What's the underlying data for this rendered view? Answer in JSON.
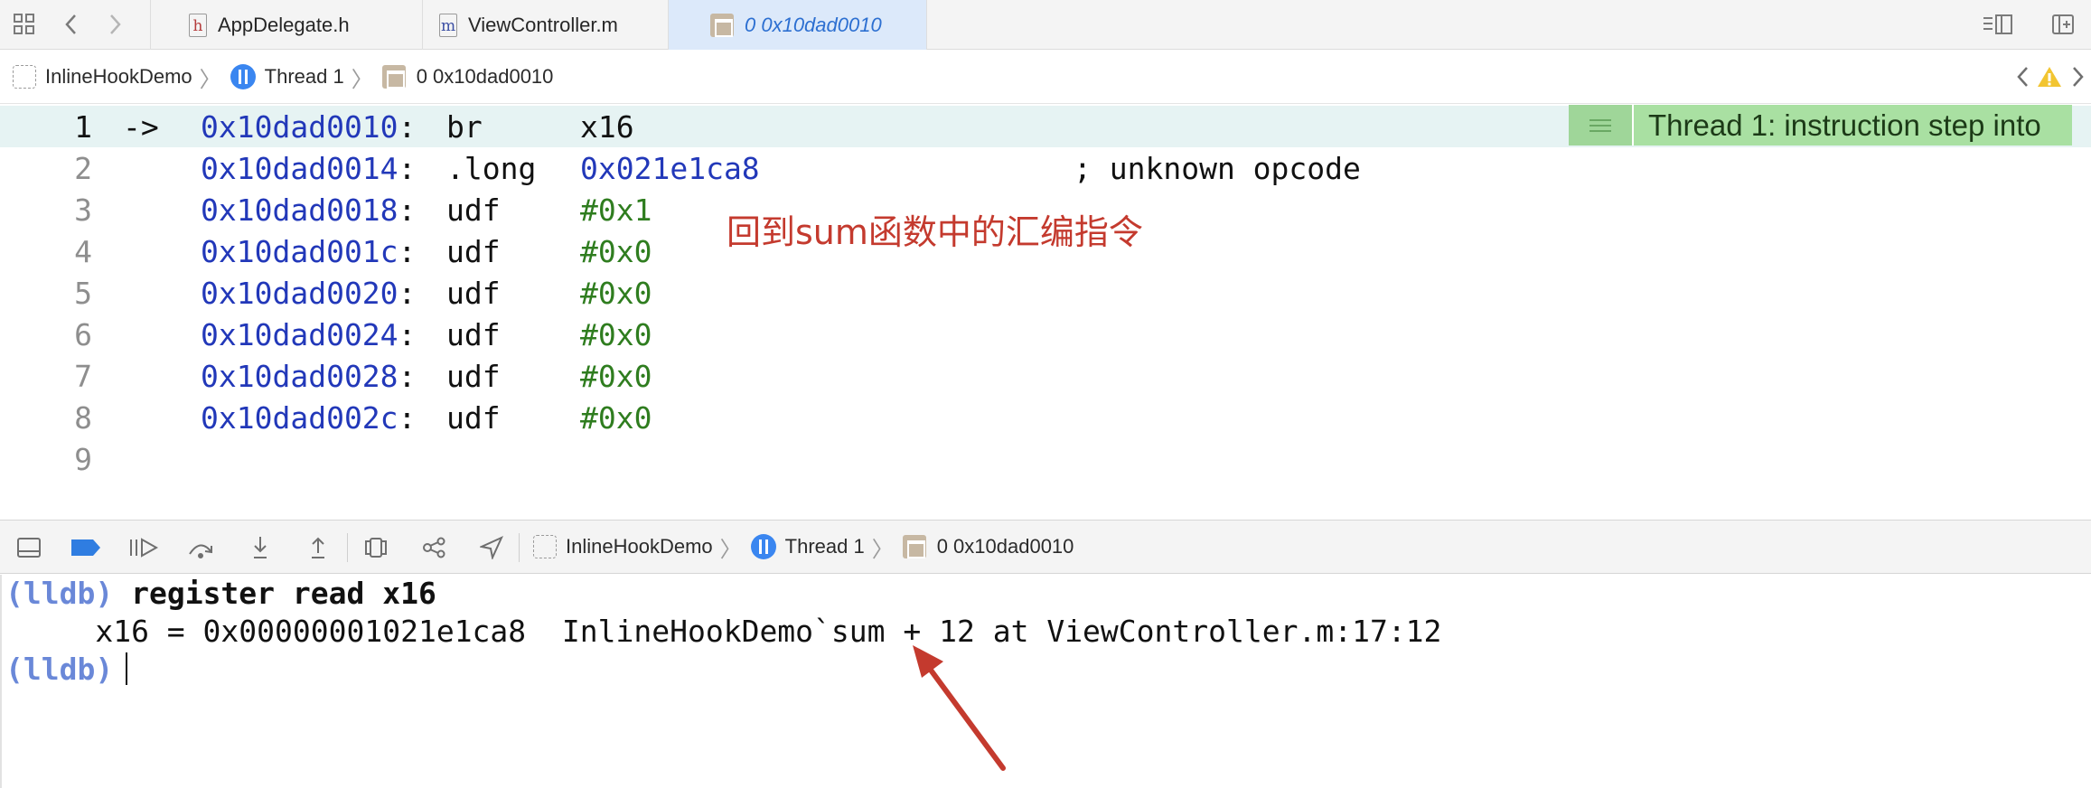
{
  "tabbar": {
    "tabs": [
      {
        "label": "AppDelegate.h",
        "glyph": "h"
      },
      {
        "label": "ViewController.m",
        "glyph": "m"
      },
      {
        "label": "0 0x10dad0010",
        "glyph": "frame"
      }
    ]
  },
  "breadcrumb": {
    "project": "InlineHookDemo",
    "thread": "Thread 1",
    "frame": "0 0x10dad0010"
  },
  "editor": {
    "lines": [
      {
        "num": "1",
        "marker": "->",
        "addr": "0x10dad0010",
        "mnemonic": "br",
        "operand": "x16",
        "operand_kind": "reg",
        "comment": ""
      },
      {
        "num": "2",
        "marker": "",
        "addr": "0x10dad0014",
        "mnemonic": ".long",
        "operand": "0x021e1ca8",
        "operand_kind": "addr",
        "comment": "; unknown opcode"
      },
      {
        "num": "3",
        "marker": "",
        "addr": "0x10dad0018",
        "mnemonic": "udf",
        "operand": "#0x1",
        "operand_kind": "num",
        "comment": ""
      },
      {
        "num": "4",
        "marker": "",
        "addr": "0x10dad001c",
        "mnemonic": "udf",
        "operand": "#0x0",
        "operand_kind": "num",
        "comment": ""
      },
      {
        "num": "5",
        "marker": "",
        "addr": "0x10dad0020",
        "mnemonic": "udf",
        "operand": "#0x0",
        "operand_kind": "num",
        "comment": ""
      },
      {
        "num": "6",
        "marker": "",
        "addr": "0x10dad0024",
        "mnemonic": "udf",
        "operand": "#0x0",
        "operand_kind": "num",
        "comment": ""
      },
      {
        "num": "7",
        "marker": "",
        "addr": "0x10dad0028",
        "mnemonic": "udf",
        "operand": "#0x0",
        "operand_kind": "num",
        "comment": ""
      },
      {
        "num": "8",
        "marker": "",
        "addr": "0x10dad002c",
        "mnemonic": "udf",
        "operand": "#0x0",
        "operand_kind": "num",
        "comment": ""
      },
      {
        "num": "9",
        "marker": "",
        "addr": "",
        "mnemonic": "",
        "operand": "",
        "operand_kind": "",
        "comment": ""
      }
    ],
    "annotation": "Thread 1: instruction step into",
    "note": "回到sum函数中的汇编指令"
  },
  "debugbar": {
    "project": "InlineHookDemo",
    "thread": "Thread 1",
    "frame": "0 0x10dad0010"
  },
  "console": {
    "prompt": "(lldb)",
    "command": "register read x16",
    "output": "     x16 = 0x00000001021e1ca8  InlineHookDemo`sum + 12 at ViewController.m:17:12"
  },
  "colors": {
    "address": "#2238b9",
    "number": "#2f7d1f",
    "current_line_bg": "#e6f3f3",
    "annotation_bg": "#a9e0a2",
    "note_red": "#c43a2e",
    "prompt": "#6a88d8",
    "active_tab": "#dce9fa"
  },
  "icons": [
    "grid-icon",
    "back-icon",
    "forward-icon",
    "split-editor-icon",
    "add-editor-icon",
    "warning-icon",
    "prev-issue-icon",
    "breakpoint-icon",
    "continue-icon",
    "step-over-icon",
    "step-into-icon",
    "step-out-icon",
    "view-hierarchy-icon",
    "memory-graph-icon",
    "location-icon",
    "toggle-console-icon"
  ]
}
